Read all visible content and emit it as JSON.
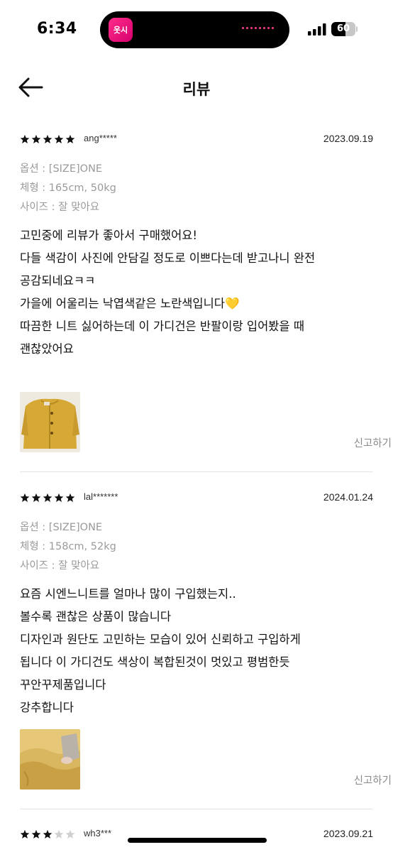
{
  "status_bar": {
    "time": "6:34",
    "app_label": "옷시",
    "battery_level": "60",
    "battery_fraction": 0.6
  },
  "header": {
    "title": "리뷰"
  },
  "reviews": [
    {
      "rating": 5,
      "reviewer": "ang*****",
      "date": "2023.09.19",
      "meta": [
        "옵션 : [SIZE]ONE",
        "체형 : 165cm, 50kg",
        "사이즈 : 잘 맞아요"
      ],
      "body": [
        "고민중에 리뷰가 좋아서 구매했어요!",
        "다들 색감이 사진에 안담길 정도로 이쁘다는데 받고나니 완전",
        "공감되네요ㅋㅋ",
        "가을에 어울리는 낙엽색같은 노란색입니다💛",
        "따끔한 니트 싫어하는데 이 가디건은 반팔이랑 입어봤을 때",
        "괜찮았어요"
      ],
      "report_label": "신고하기"
    },
    {
      "rating": 5,
      "reviewer": "lal*******",
      "date": "2024.01.24",
      "meta": [
        "옵션 : [SIZE]ONE",
        "체형 : 158cm, 52kg",
        "사이즈 : 잘 맞아요"
      ],
      "body": [
        "요즘 시엔느니트를 얼마나 많이 구입했는지..",
        "볼수록 괜찮은  상품이 많습니다",
        "디자인과 원단도 고민하는 모습이 있어 신뢰하고 구입하게",
        "됩니다 이 가디건도 색상이 복합된것이 멋있고 평범한듯",
        "꾸안꾸제품입니다",
        "강추합니다"
      ],
      "report_label": "신고하기"
    },
    {
      "rating": 3,
      "reviewer": "wh3***",
      "date": "2023.09.21"
    }
  ],
  "colors": {
    "star_filled": "#111111",
    "star_empty": "#d0d0d0",
    "meta_text": "#9a9a9a",
    "report_text": "#8a8a8a",
    "island_app": "#e8107a"
  },
  "icons": {
    "back": "arrow-left-icon",
    "star": "star-icon",
    "signal": "cellular-signal-icon",
    "battery": "battery-icon"
  }
}
